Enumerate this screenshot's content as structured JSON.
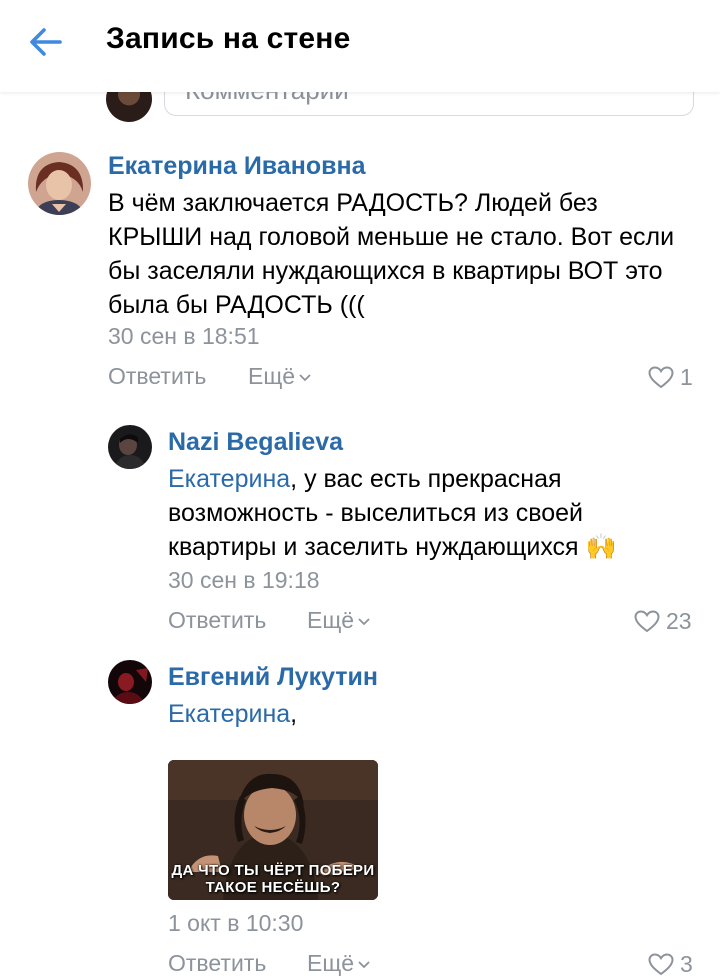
{
  "header": {
    "title": "Запись на стене"
  },
  "comment_input": {
    "placeholder": "Комментарий"
  },
  "comments": [
    {
      "author": "Екатерина Ивановна",
      "text": "В чём заключается РАДОСТЬ? Людей без КРЫШИ над головой меньше не стало. Вот если бы заселяли нуждающихся в квартиры ВОТ это была бы РАДОСТЬ (((",
      "time": "30 сен в 18:51",
      "reply_label": "Ответить",
      "more_label": "Ещё",
      "likes": "1"
    },
    {
      "author": "Nazi Begalieva",
      "mention": "Екатерина",
      "text": ", у вас есть прекрасная возможность - выселиться из своей квартиры и заселить нуждающихся",
      "emoji": "🙌",
      "time": "30 сен в 19:18",
      "reply_label": "Ответить",
      "more_label": "Ещё",
      "likes": "23"
    },
    {
      "author": "Евгений Лукутин",
      "mention": "Екатерина",
      "text": ",",
      "meme_caption_line1": "ДА ЧТО ТЫ ЧЁРТ ПОБЕРИ",
      "meme_caption_line2": "ТАКОЕ НЕСЁШЬ?",
      "time": "1 окт в 10:30",
      "reply_label": "Ответить",
      "more_label": "Ещё",
      "likes": "3"
    }
  ],
  "colors": {
    "link": "#2a6aa8",
    "muted": "#8c939b",
    "back_arrow": "#3f8ae0"
  }
}
